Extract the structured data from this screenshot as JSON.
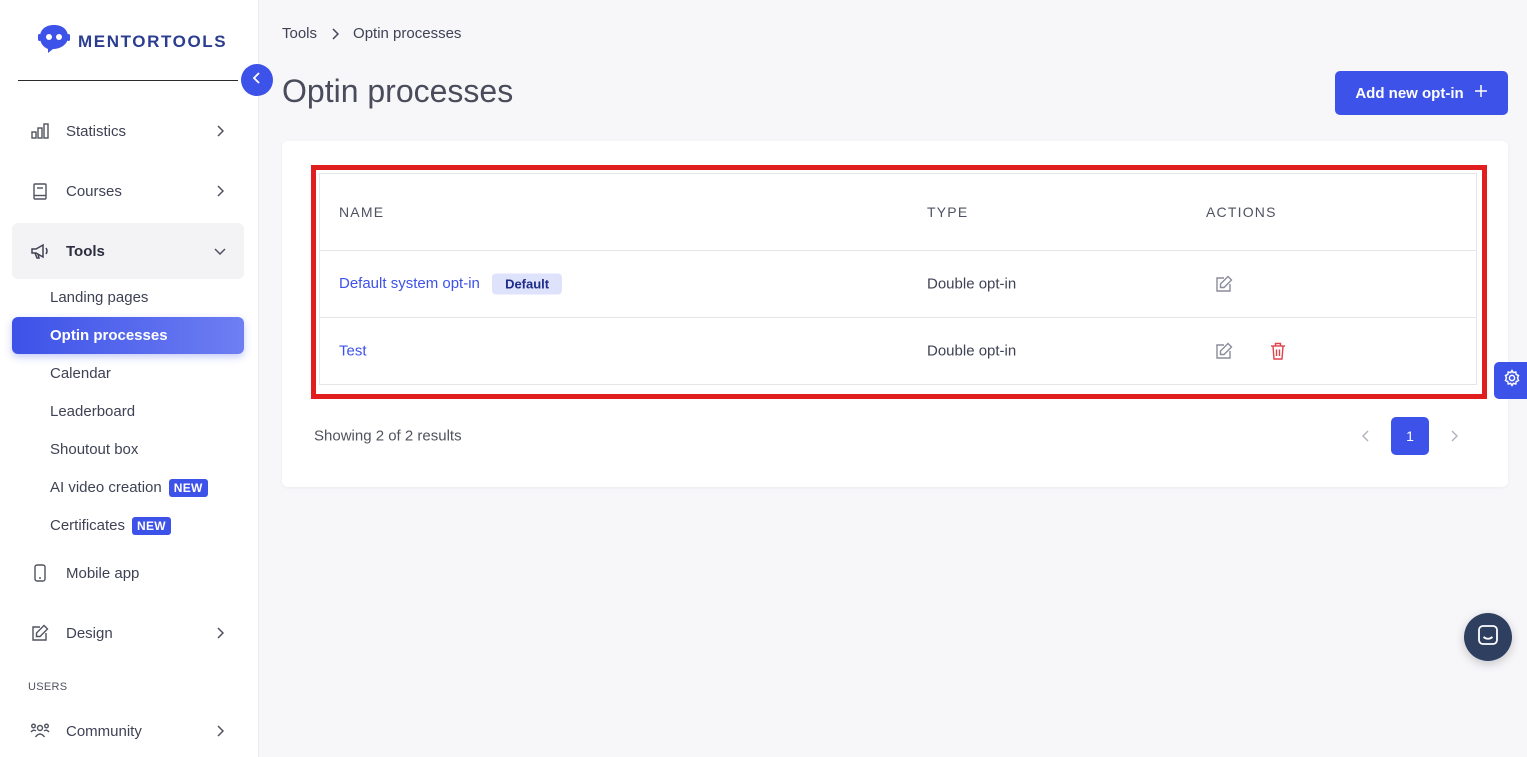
{
  "app": {
    "logo_text": "MENTORTOOLS"
  },
  "sidebar": {
    "items": [
      {
        "id": "statistics",
        "label": "Statistics",
        "icon": "bar-chart-icon"
      },
      {
        "id": "courses",
        "label": "Courses",
        "icon": "book-icon"
      },
      {
        "id": "tools",
        "label": "Tools",
        "icon": "megaphone-icon"
      },
      {
        "id": "mobile",
        "label": "Mobile app",
        "icon": "phone-icon"
      },
      {
        "id": "design",
        "label": "Design",
        "icon": "pencil-square-icon"
      },
      {
        "id": "community",
        "label": "Community",
        "icon": "users-icon"
      }
    ],
    "tools_sub": [
      {
        "label": "Landing pages"
      },
      {
        "label": "Optin processes"
      },
      {
        "label": "Calendar"
      },
      {
        "label": "Leaderboard"
      },
      {
        "label": "Shoutout box"
      },
      {
        "label": "AI video creation",
        "badge": "NEW"
      },
      {
        "label": "Certificates",
        "badge": "NEW"
      }
    ],
    "section_users": "USERS"
  },
  "breadcrumb": {
    "parent": "Tools",
    "current": "Optin processes"
  },
  "page": {
    "title": "Optin processes",
    "add_button": "Add new opt-in"
  },
  "table": {
    "headers": {
      "name": "NAME",
      "type": "TYPE",
      "actions": "ACTIONS"
    },
    "rows": [
      {
        "name": "Default system opt-in",
        "tag": "Default",
        "type": "Double opt-in"
      },
      {
        "name": "Test",
        "type": "Double opt-in"
      }
    ]
  },
  "pagination": {
    "summary": "Showing 2 of 2 results",
    "current_page": "1"
  },
  "colors": {
    "accent": "#3d52e8",
    "highlight": "#e01e1e",
    "danger": "#e0424b"
  }
}
